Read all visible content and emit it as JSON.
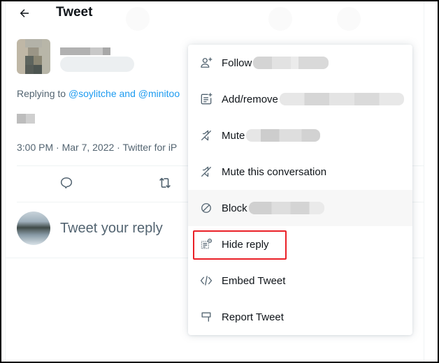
{
  "header": {
    "title": "Tweet",
    "back_icon": "arrow-left-icon"
  },
  "tweet": {
    "author_name": "[blurred]",
    "author_handle": "[blurred]",
    "replying_prefix": "Replying to ",
    "mentions": "@soylitche and @minitoo",
    "text": "[blurred]",
    "meta": "3:00 PM · Mar 7, 2022 · Twitter for iP",
    "actions": [
      {
        "name": "reply",
        "icon": "reply-icon"
      },
      {
        "name": "retweet",
        "icon": "retweet-icon"
      }
    ]
  },
  "composer": {
    "placeholder": "Tweet your reply"
  },
  "menu": {
    "items": [
      {
        "label": "Follow",
        "icon": "follow-user-icon",
        "redacted": true
      },
      {
        "label": "Add/remove",
        "icon": "list-add-icon",
        "redacted": true
      },
      {
        "label": "Mute",
        "icon": "mute-icon",
        "redacted": true
      },
      {
        "label": "Mute this conversation",
        "icon": "mute-icon",
        "redacted": false
      },
      {
        "label": "Block",
        "icon": "block-icon",
        "redacted": true,
        "hovered": true
      },
      {
        "label": "Hide reply",
        "icon": "hide-reply-icon",
        "redacted": false,
        "highlighted": true
      },
      {
        "label": "Embed Tweet",
        "icon": "code-icon",
        "redacted": false
      },
      {
        "label": "Report Tweet",
        "icon": "flag-icon",
        "redacted": false
      }
    ]
  },
  "colors": {
    "accent": "#1d9bf0",
    "text_secondary": "#536471",
    "highlight_border": "#ea2027",
    "hover_bg": "#f7f7f7"
  }
}
